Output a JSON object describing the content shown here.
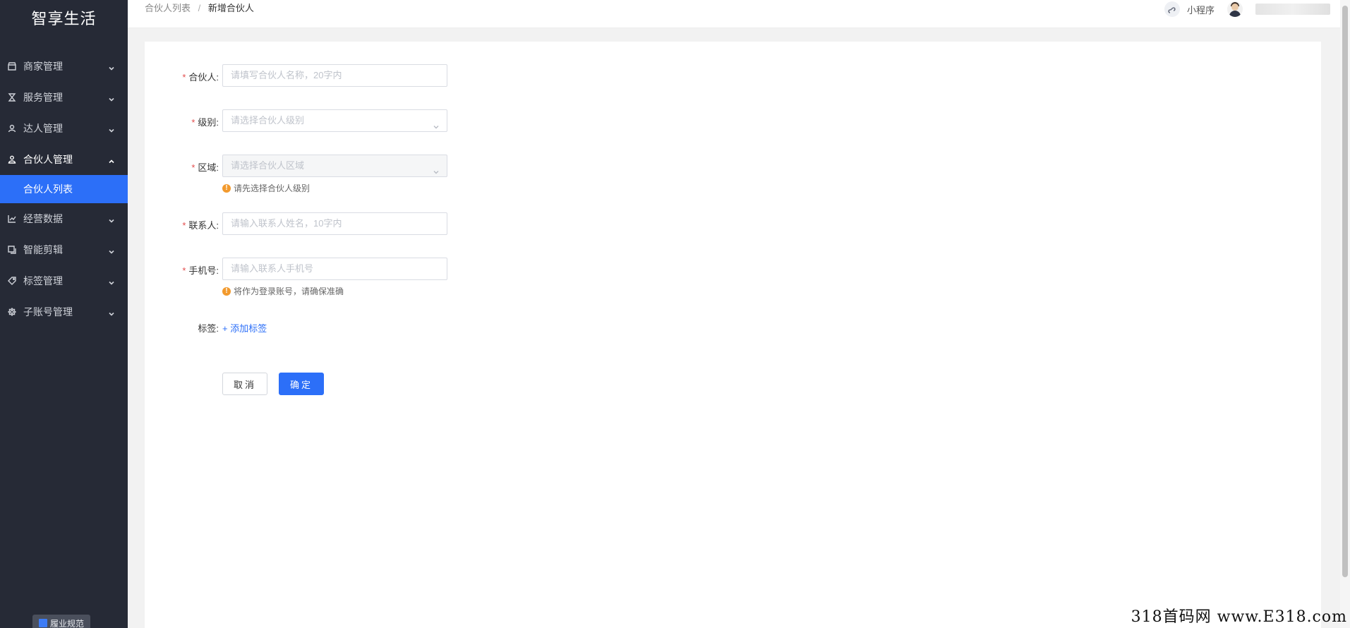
{
  "sidebar": {
    "brand": "智享生活",
    "items": [
      {
        "label": "商家管理",
        "icon": "store-icon"
      },
      {
        "label": "服务管理",
        "icon": "hourglass-icon"
      },
      {
        "label": "达人管理",
        "icon": "person-icon"
      },
      {
        "label": "合伙人管理",
        "icon": "partner-icon",
        "open": true
      },
      {
        "label": "经营数据",
        "icon": "chart-icon"
      },
      {
        "label": "智能剪辑",
        "icon": "edit-icon"
      },
      {
        "label": "标签管理",
        "icon": "tag-icon"
      },
      {
        "label": "子账号管理",
        "icon": "settings-icon"
      }
    ],
    "active_sub": "合伙人列表",
    "footer_badge": "履业规范"
  },
  "header": {
    "breadcrumb": [
      "合伙人列表",
      "新增合伙人"
    ],
    "breadcrumb_sep": "/",
    "mini_program": "小程序"
  },
  "form": {
    "partner": {
      "label": "合伙人:",
      "placeholder": "请填写合伙人名称，20字内"
    },
    "level": {
      "label": "级别:",
      "placeholder": "请选择合伙人级别"
    },
    "region": {
      "label": "区域:",
      "placeholder": "请选择合伙人区域",
      "hint": "请先选择合伙人级别"
    },
    "contact": {
      "label": "联系人:",
      "placeholder": "请输入联系人姓名，10字内"
    },
    "phone": {
      "label": "手机号:",
      "placeholder": "请输入联系人手机号",
      "hint": "将作为登录账号，请确保准确"
    },
    "tags": {
      "label": "标签:",
      "add": "+ 添加标签"
    },
    "cancel": "取消",
    "confirm": "确定",
    "required_mark": "*",
    "warn_glyph": "!"
  },
  "watermark": "318首码网 www.E318.com",
  "colors": {
    "sidebar": "#262a36",
    "accent": "#2c6ff8",
    "required": "#e34d4d",
    "warning": "#f29a2e"
  }
}
